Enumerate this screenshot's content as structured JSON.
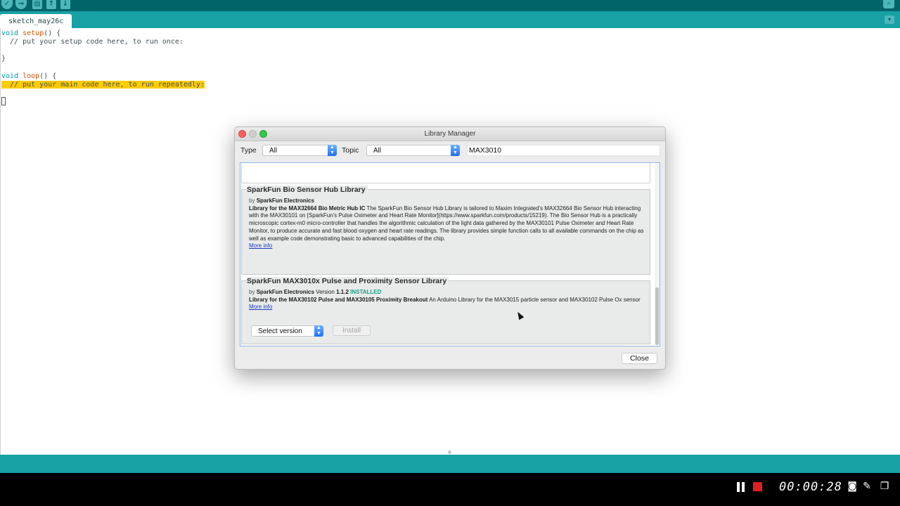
{
  "toolbar": {
    "verify_icon": "✓",
    "upload_icon": "→",
    "new_icon": "▤",
    "open_icon": "↑",
    "save_icon": "↓",
    "serial_icon": "⌕"
  },
  "tabs": [
    {
      "label": "sketch_may26c"
    }
  ],
  "tab_menu_icon": "▾",
  "editor": {
    "line1": {
      "kw": "void",
      "fn": "setup",
      "rest": "() {"
    },
    "line2": "  // put your setup code here, to run once:",
    "line3": "}",
    "line4": {
      "kw": "void",
      "fn": "loop",
      "rest": "() {"
    },
    "line5": "  // put your main code here, to run repeatedly:",
    "line6": "}"
  },
  "dialog": {
    "title": "Library Manager",
    "type_label": "Type",
    "type_value": "All",
    "topic_label": "Topic",
    "topic_value": "All",
    "search_value": "MAX3010",
    "libraries": [
      {
        "title": "SparkFun Bio Sensor Hub Library",
        "by_prefix": "by",
        "author": "SparkFun Electronics",
        "summary": "Library for the MAX32664 Bio Metric Hub IC",
        "description": "The SparkFun Bio Sensor Hub Library is tailored to Maxim Integrated's MAX32664 Bio Sensor Hub interacting with the MAX30101 on [SparkFun's Pulse Oximeter and Heart Rate Monitor](https://www.sparkfun.com/products/15219). The Bio Sensor Hub is a practically microscopic cortex-m0 micro-controller that handles the algorithmic calculation of the light data gathered by the MAX30101 Pulse Oximeter and Heart Rate Monitor, to produce accurate and fast blood oxygen and heart rate readings. The library provides simple function calls to all available commands on the chip as well as example code demonstrating basic to advanced capabilities of the chip.",
        "more_info": "More info"
      },
      {
        "title": "SparkFun MAX3010x Pulse and Proximity Sensor Library",
        "by_prefix": "by",
        "author": "SparkFun Electronics",
        "version_label": "Version",
        "version": "1.1.2",
        "installed": "INSTALLED",
        "summary": "Library for the MAX30102 Pulse and MAX30105 Proximity Breakout",
        "description": "An Arduino Library for the MAX3015 particle sensor and MAX30102 Pulse Ox sensor",
        "more_info": "More info",
        "select_version": "Select version",
        "install_label": "Install"
      }
    ],
    "close_label": "Close"
  },
  "recorder": {
    "time": "00:00:28",
    "camera_icon": "◙",
    "pen_icon": "✎",
    "window_icon": "❐"
  }
}
